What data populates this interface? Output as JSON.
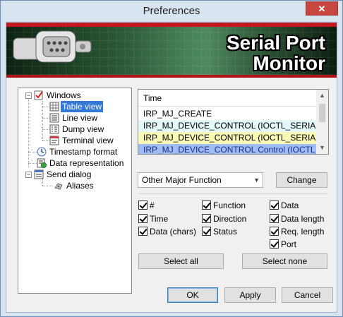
{
  "window": {
    "title": "Preferences",
    "close_glyph": "✕"
  },
  "banner": {
    "line1": "Serial Port",
    "line2": "Monitor"
  },
  "tree": {
    "windows": "Windows",
    "table_view": "Table view",
    "line_view": "Line view",
    "dump_view": "Dump view",
    "terminal_view": "Terminal view",
    "timestamp_format": "Timestamp format",
    "data_representation": "Data representation",
    "send_dialog": "Send dialog",
    "aliases": "Aliases"
  },
  "preview": {
    "header": "Time",
    "rows": [
      "IRP_MJ_CREATE",
      "IRP_MJ_DEVICE_CONTROL (IOCTL_SERIAL_GET_...",
      "IRP_MJ_DEVICE_CONTROL (IOCTL_SERIAL_SET_...",
      "IRP_MJ_DEVICE_CONTROL Control (IOCTL_SERIA"
    ],
    "row_colors": [
      "#ffffff",
      "#e4f7f9",
      "#fafab7",
      "#9dbdf3"
    ]
  },
  "combo": {
    "value": "Other Major Function"
  },
  "buttons": {
    "change": "Change",
    "select_all": "Select all",
    "select_none": "Select none",
    "ok": "OK",
    "apply": "Apply",
    "cancel": "Cancel"
  },
  "columns": {
    "number": {
      "label": "#",
      "checked": true
    },
    "time": {
      "label": "Time",
      "checked": true
    },
    "data_chars": {
      "label": "Data (chars)",
      "checked": true
    },
    "function": {
      "label": "Function",
      "checked": true
    },
    "direction": {
      "label": "Direction",
      "checked": true
    },
    "status": {
      "label": "Status",
      "checked": true
    },
    "data": {
      "label": "Data",
      "checked": true
    },
    "data_length": {
      "label": "Data length",
      "checked": true
    },
    "req_length": {
      "label": "Req. length",
      "checked": true
    },
    "port": {
      "label": "Port",
      "checked": true
    }
  },
  "colors": {
    "selection": "#3478d6",
    "banner_red": "#c3181e",
    "close_button": "#c7463f"
  }
}
